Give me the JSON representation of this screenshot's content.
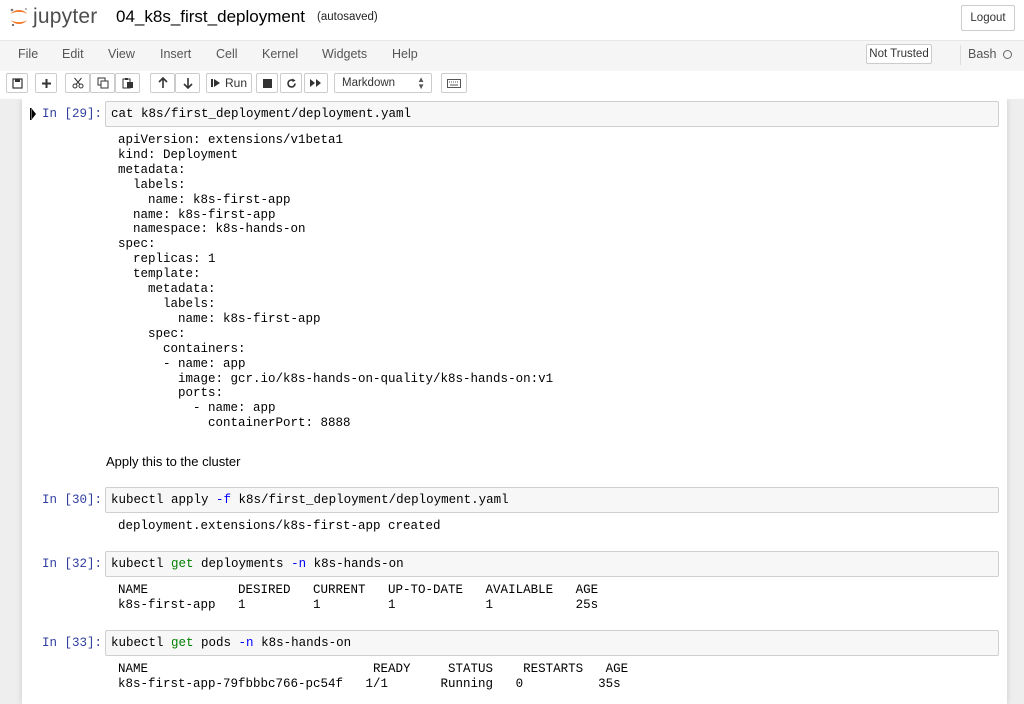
{
  "header": {
    "logo_text": "jupyter",
    "notebook_title": "04_k8s_first_deployment",
    "autosave_status": "(autosaved)",
    "logout_label": "Logout"
  },
  "menu": {
    "items": [
      "File",
      "Edit",
      "View",
      "Insert",
      "Cell",
      "Kernel",
      "Widgets",
      "Help"
    ],
    "trust_label": "Not Trusted",
    "kernel_name": "Bash"
  },
  "toolbar": {
    "run_label": "Run",
    "cell_type": "Markdown",
    "icons": [
      "save-icon",
      "plus-icon",
      "cut-icon",
      "copy-icon",
      "paste-icon",
      "arrow-up-icon",
      "arrow-down-icon",
      "run-icon",
      "stop-icon",
      "restart-icon",
      "fast-forward-icon",
      "keyboard-icon"
    ]
  },
  "cells": [
    {
      "prompt": "In [29]:",
      "input": "cat k8s/first_deployment/deployment.yaml",
      "output": "apiVersion: extensions/v1beta1\nkind: Deployment\nmetadata:\n  labels:\n    name: k8s-first-app\n  name: k8s-first-app\n  namespace: k8s-hands-on\nspec:\n  replicas: 1\n  template:\n    metadata:\n      labels:\n        name: k8s-first-app\n    spec:\n      containers:\n      - name: app\n        image: gcr.io/k8s-hands-on-quality/k8s-hands-on:v1\n        ports:\n          - name: app\n            containerPort: 8888"
    },
    {
      "markdown": "Apply this to the cluster"
    },
    {
      "prompt": "In [30]:",
      "input_parts": [
        "kubectl apply ",
        "-f",
        " k8s/first_deployment/deployment.yaml"
      ],
      "output": "deployment.extensions/k8s-first-app created"
    },
    {
      "prompt": "In [32]:",
      "input_parts": [
        "kubectl ",
        "get",
        " deployments ",
        "-n",
        " k8s-hands-on"
      ],
      "output": "NAME            DESIRED   CURRENT   UP-TO-DATE   AVAILABLE   AGE\nk8s-first-app   1         1         1            1           25s"
    },
    {
      "prompt": "In [33]:",
      "input_parts": [
        "kubectl ",
        "get",
        " pods ",
        "-n",
        " k8s-hands-on"
      ],
      "output": "NAME                              READY     STATUS    RESTARTS   AGE\nk8s-first-app-79fbbbc766-pc54f   1/1       Running   0          35s"
    }
  ],
  "colors": {
    "prompt": "#303f9f",
    "keyword": "#008000",
    "option": "#0000ff",
    "logo_orange": "#f37726"
  }
}
